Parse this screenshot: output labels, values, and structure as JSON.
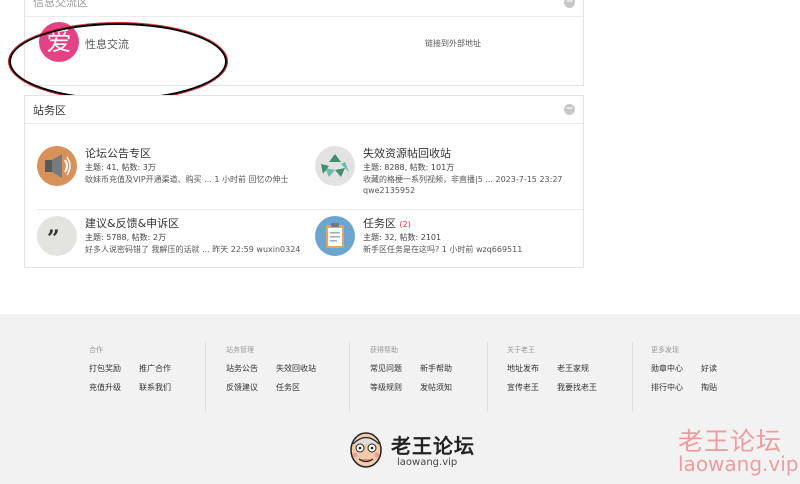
{
  "panel_info": {
    "title": "信息交流区",
    "forum": {
      "icon_char": "爱",
      "name": "性息交流",
      "link": "链接到外部地址"
    }
  },
  "panel_station": {
    "title": "站务区",
    "forums": [
      {
        "name": "论坛公告专区",
        "stats": "主题: 41, 帖数: 3万",
        "last": "蚊妹币充值及VIP开通渠道、购买 ... 1 小时前 回忆の伸士",
        "last2": ""
      },
      {
        "name": "失效资源帖回收站",
        "stats": "主题: 8288, 帖数: 101万",
        "last": "收藏的格梗一系列视频，非直播|5 ... 2023-7-15 23:27",
        "last2": "qwe2135952"
      },
      {
        "name": "建议&反馈&申诉区",
        "stats": "主题: 5788, 帖数: 2万",
        "last": "好多人说密码错了 我解压的话就 ... 昨天 22:59 wuxin0324",
        "last2": ""
      },
      {
        "name": "任务区",
        "badge": "(2)",
        "stats": "主题: 32, 帖数: 2101",
        "last": "新手区任务是在这吗? 1 小时前 wzq669511",
        "last2": ""
      }
    ]
  },
  "footer": {
    "columns": [
      {
        "title": "合作",
        "links": [
          "打包奖励",
          "推广合作",
          "充值升级",
          "联系我们"
        ]
      },
      {
        "title": "站务管理",
        "links": [
          "站务公告",
          "失效回收站",
          "反馈建议",
          "任务区"
        ]
      },
      {
        "title": "获得帮助",
        "links": [
          "常见问题",
          "新手帮助",
          "等级规则",
          "发帖须知"
        ]
      },
      {
        "title": "关于老王",
        "links": [
          "地址发布",
          "老王家规",
          "宣传老王",
          "我要找老王"
        ]
      },
      {
        "title": "更多发现",
        "links": [
          "勋章中心",
          "好读",
          "排行中心",
          "掏贴"
        ]
      }
    ],
    "logo_text": "老王论坛",
    "logo_domain": "laowang.vip"
  },
  "watermark": {
    "line1": "老王论坛",
    "line2": "laowang.vip"
  }
}
